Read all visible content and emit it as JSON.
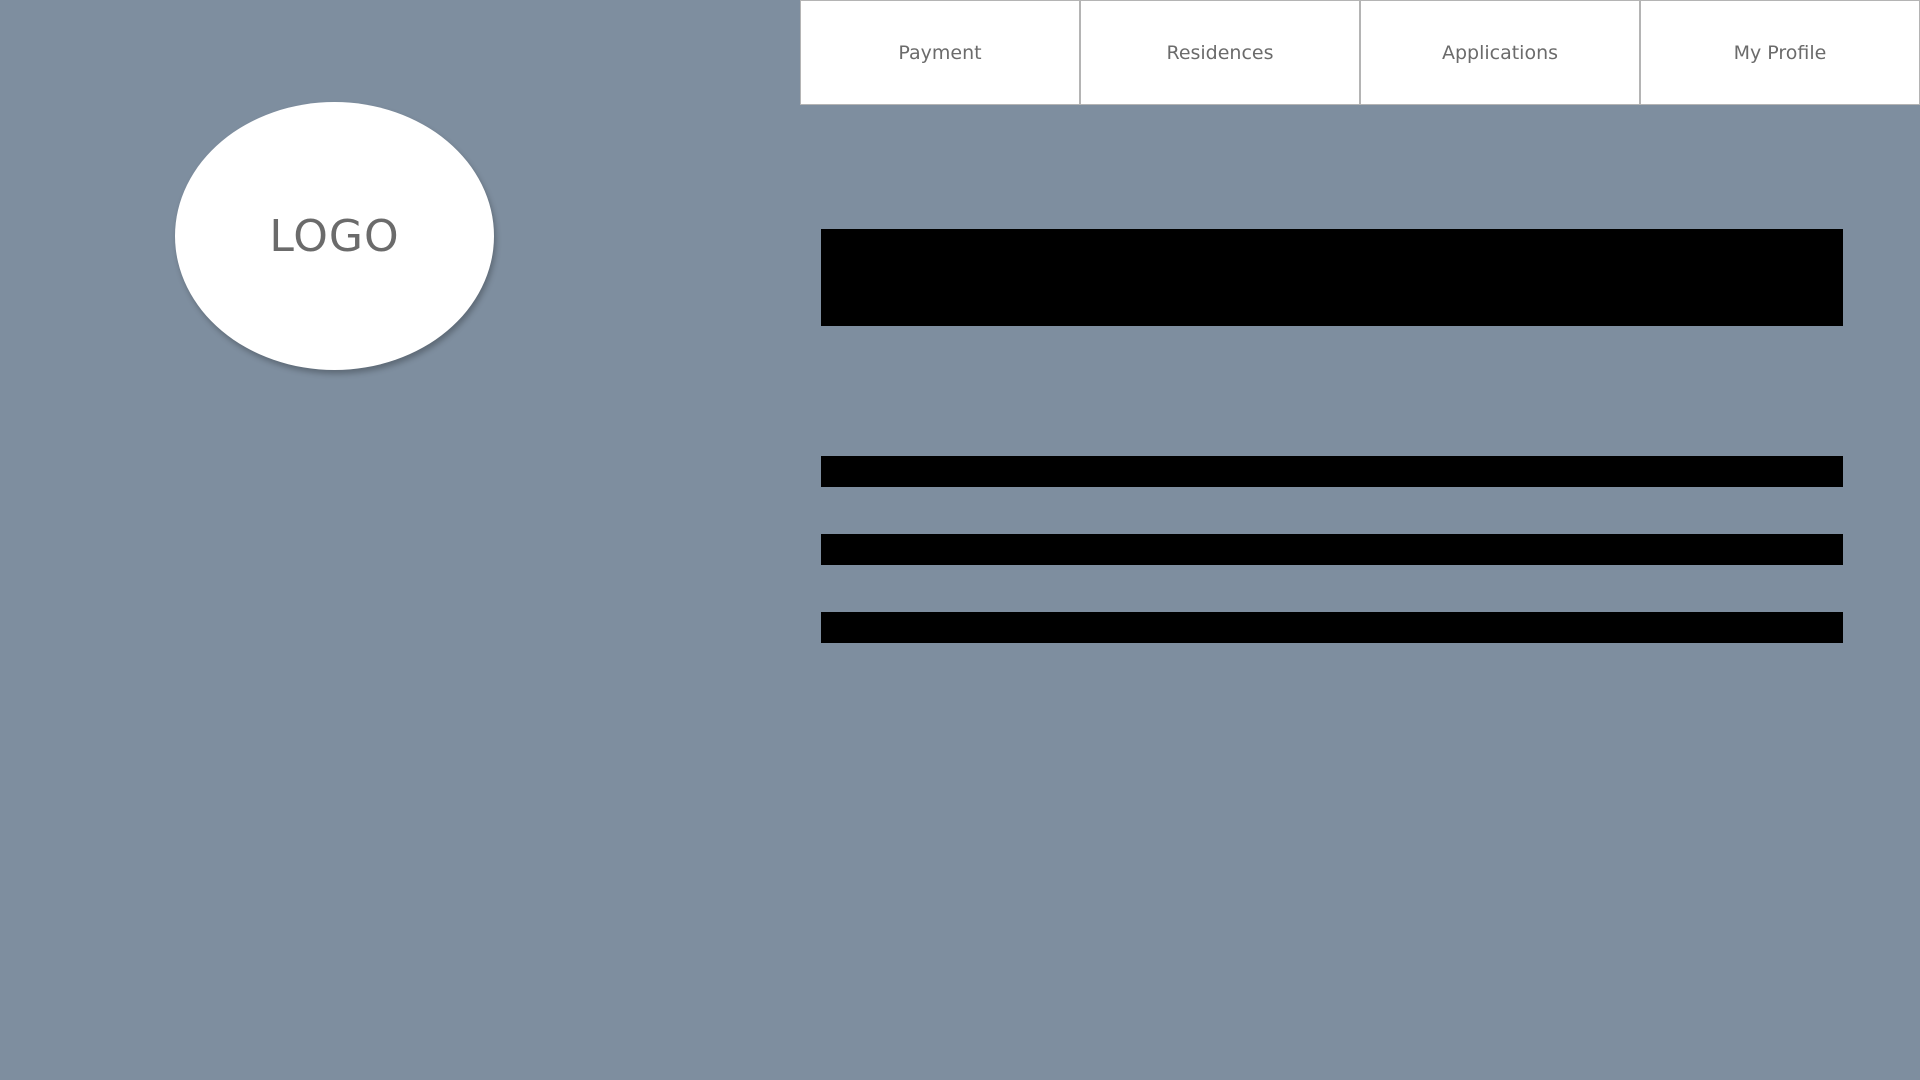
{
  "nav": {
    "items": [
      {
        "label": "Payment"
      },
      {
        "label": "Residences"
      },
      {
        "label": "Applications"
      },
      {
        "label": "My Profile"
      }
    ]
  },
  "logo": {
    "text": "LOGO"
  },
  "colors": {
    "background": "#7e8e9f",
    "nav_background": "#ffffff",
    "nav_text": "#6b6b6b",
    "redaction": "#000000"
  }
}
